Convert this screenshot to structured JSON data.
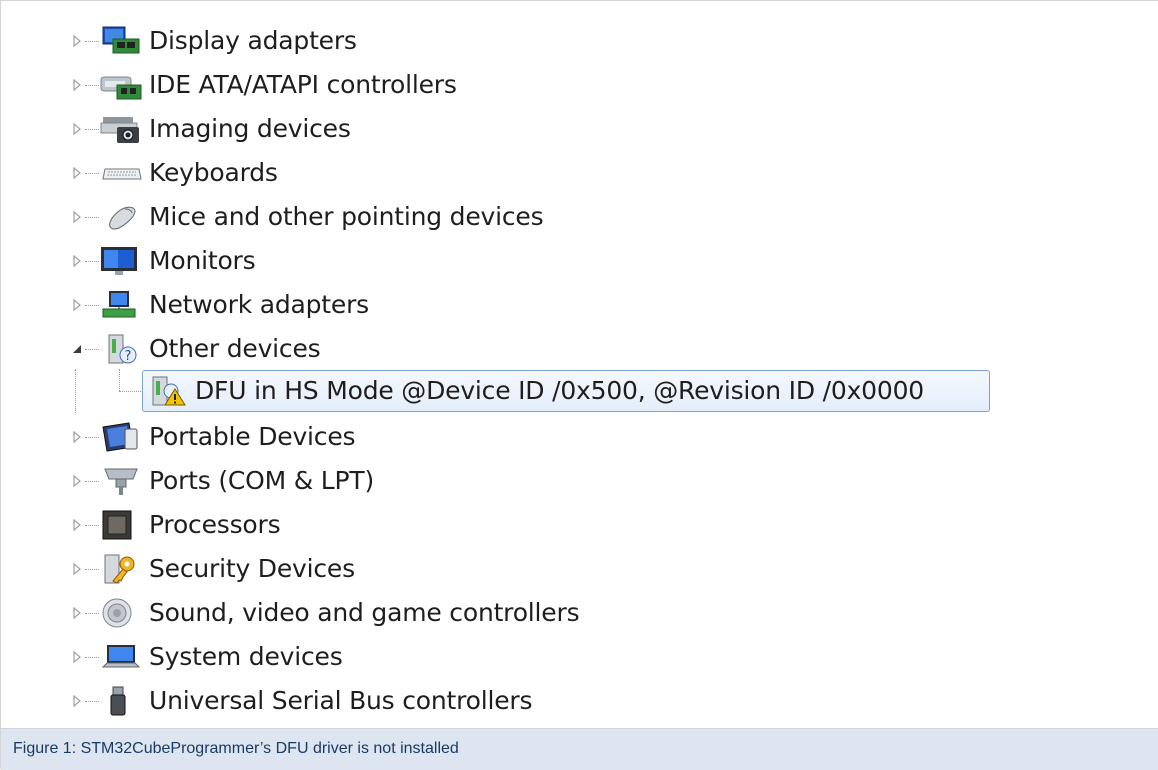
{
  "tree": {
    "categories": [
      {
        "label": "Display adapters",
        "icon": "display-adapter-icon",
        "expanded": false
      },
      {
        "label": "IDE ATA/ATAPI controllers",
        "icon": "ide-controller-icon",
        "expanded": false
      },
      {
        "label": "Imaging devices",
        "icon": "camera-icon",
        "expanded": false
      },
      {
        "label": "Keyboards",
        "icon": "keyboard-icon",
        "expanded": false
      },
      {
        "label": "Mice and other pointing devices",
        "icon": "mouse-icon",
        "expanded": false
      },
      {
        "label": "Monitors",
        "icon": "monitor-icon",
        "expanded": false
      },
      {
        "label": "Network adapters",
        "icon": "network-adapter-icon",
        "expanded": false
      },
      {
        "label": "Other devices",
        "icon": "unknown-device-icon",
        "expanded": true
      },
      {
        "label": "Portable Devices",
        "icon": "portable-device-icon",
        "expanded": false
      },
      {
        "label": "Ports (COM & LPT)",
        "icon": "port-icon",
        "expanded": false
      },
      {
        "label": "Processors",
        "icon": "processor-icon",
        "expanded": false
      },
      {
        "label": "Security Devices",
        "icon": "security-key-icon",
        "expanded": false
      },
      {
        "label": "Sound, video and game controllers",
        "icon": "speaker-icon",
        "expanded": false
      },
      {
        "label": "System devices",
        "icon": "system-device-icon",
        "expanded": false
      },
      {
        "label": "Universal Serial Bus controllers",
        "icon": "usb-icon",
        "expanded": false
      }
    ],
    "child": {
      "label": "DFU in HS Mode @Device ID /0x500, @Revision ID /0x0000",
      "icon": "warning-device-icon",
      "selected": true
    }
  },
  "caption": "Figure 1: STM32CubeProgrammer’s DFU driver is not installed",
  "colors": {
    "selection_border": "#7da2ce",
    "caption_background": "#dde6f0",
    "caption_text": "#1a3a66"
  }
}
